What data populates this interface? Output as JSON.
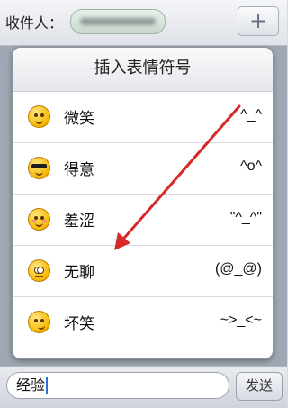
{
  "recipient": {
    "label": "收件人："
  },
  "header": {
    "add_label": "+"
  },
  "popover": {
    "title": "插入表情符号",
    "items": [
      {
        "name": "微笑",
        "code": "^_^",
        "icon": "smile-face-icon"
      },
      {
        "name": "得意",
        "code": "^o^",
        "icon": "cool-face-icon"
      },
      {
        "name": "羞涩",
        "code": "\"^_^\"",
        "icon": "shy-face-icon"
      },
      {
        "name": "无聊",
        "code": "(@_@)",
        "icon": "bored-face-icon"
      },
      {
        "name": "坏笑",
        "code": "~>_<~",
        "icon": "sly-face-icon"
      }
    ]
  },
  "compose": {
    "value": "经验",
    "send_label": "发送"
  },
  "colors": {
    "arrow": "#d62a2a",
    "accent": "#f6b900"
  }
}
